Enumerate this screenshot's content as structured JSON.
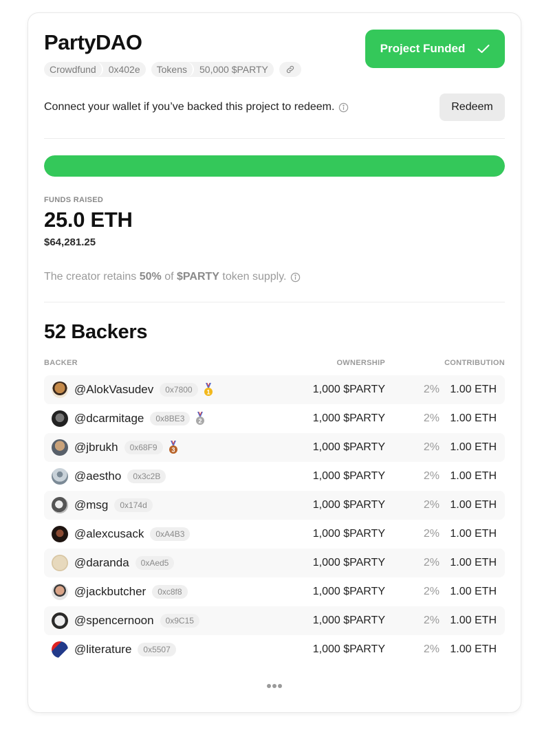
{
  "project": {
    "title": "PartyDAO",
    "chips": [
      {
        "label": "Crowdfund",
        "value": "0x402e"
      },
      {
        "label": "Tokens",
        "value": "50,000 $PARTY"
      }
    ],
    "link_icon": "link-icon"
  },
  "status_button": {
    "label": "Project Funded",
    "icon": "checkmark-icon"
  },
  "redeem": {
    "text": "Connect your wallet if you’ve backed this project to redeem.",
    "info_icon": "info-icon",
    "button_label": "Redeem"
  },
  "progress": {
    "percent": 100,
    "color": "#34c85a"
  },
  "funds": {
    "label": "FUNDS RAISED",
    "eth": "25.0 ETH",
    "usd": "$64,281.25"
  },
  "retains": {
    "prefix": "The creator retains ",
    "percent": "50%",
    "middle": " of ",
    "token": "$PARTY",
    "suffix": " token supply."
  },
  "backers": {
    "title": "52 Backers",
    "columns": {
      "backer": "BACKER",
      "ownership": "OWNERSHIP",
      "contribution": "CONTRIBUTION"
    },
    "rows": [
      {
        "handle": "@AlokVasudev",
        "address": "0x7800",
        "medal": "1",
        "ownership": "1,000 $PARTY",
        "percent": "2%",
        "contribution": "1.00 ETH"
      },
      {
        "handle": "@dcarmitage",
        "address": "0x8BE3",
        "medal": "2",
        "ownership": "1,000 $PARTY",
        "percent": "2%",
        "contribution": "1.00 ETH"
      },
      {
        "handle": "@jbrukh",
        "address": "0x68F9",
        "medal": "3",
        "ownership": "1,000 $PARTY",
        "percent": "2%",
        "contribution": "1.00 ETH"
      },
      {
        "handle": "@aestho",
        "address": "0x3c2B",
        "medal": "",
        "ownership": "1,000 $PARTY",
        "percent": "2%",
        "contribution": "1.00 ETH"
      },
      {
        "handle": "@msg",
        "address": "0x174d",
        "medal": "",
        "ownership": "1,000 $PARTY",
        "percent": "2%",
        "contribution": "1.00 ETH"
      },
      {
        "handle": "@alexcusack",
        "address": "0xA4B3",
        "medal": "",
        "ownership": "1,000 $PARTY",
        "percent": "2%",
        "contribution": "1.00 ETH"
      },
      {
        "handle": "@daranda",
        "address": "0xAed5",
        "medal": "",
        "ownership": "1,000 $PARTY",
        "percent": "2%",
        "contribution": "1.00 ETH"
      },
      {
        "handle": "@jackbutcher",
        "address": "0xc8f8",
        "medal": "",
        "ownership": "1,000 $PARTY",
        "percent": "2%",
        "contribution": "1.00 ETH"
      },
      {
        "handle": "@spencernoon",
        "address": "0x9C15",
        "medal": "",
        "ownership": "1,000 $PARTY",
        "percent": "2%",
        "contribution": "1.00 ETH"
      },
      {
        "handle": "@literature",
        "address": "0x5507",
        "medal": "",
        "ownership": "1,000 $PARTY",
        "percent": "2%",
        "contribution": "1.00 ETH"
      }
    ],
    "more_icon": "ellipsis-icon"
  },
  "colors": {
    "accent": "#34c85a",
    "gold": "#f2b81c",
    "silver": "#a8a8a8",
    "bronze": "#b8642a"
  }
}
